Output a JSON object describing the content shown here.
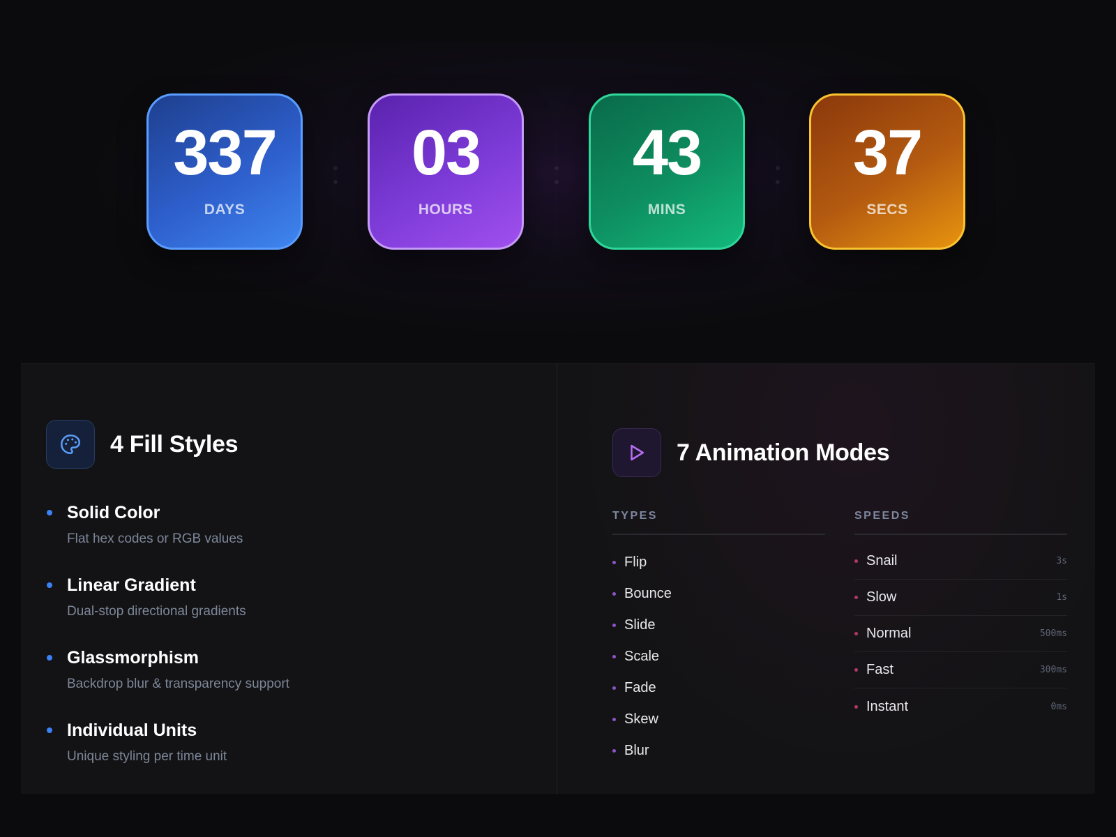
{
  "countdown": {
    "units": [
      {
        "value": "337",
        "label": "DAYS"
      },
      {
        "value": "03",
        "label": "HOURS"
      },
      {
        "value": "43",
        "label": "MINS"
      },
      {
        "value": "37",
        "label": "SECS"
      }
    ]
  },
  "fill_styles": {
    "icon": "palette-icon",
    "title": "4 Fill Styles",
    "items": [
      {
        "title": "Solid Color",
        "desc": "Flat hex codes or RGB values"
      },
      {
        "title": "Linear Gradient",
        "desc": "Dual-stop directional gradients"
      },
      {
        "title": "Glassmorphism",
        "desc": "Backdrop blur & transparency support"
      },
      {
        "title": "Individual Units",
        "desc": "Unique styling per time unit"
      }
    ]
  },
  "animation_modes": {
    "icon": "play-icon",
    "title": "7 Animation Modes",
    "types_label": "TYPES",
    "speeds_label": "SPEEDS",
    "types": [
      "Flip",
      "Bounce",
      "Slide",
      "Scale",
      "Fade",
      "Skew",
      "Blur"
    ],
    "speeds": [
      {
        "name": "Snail",
        "value": "3s"
      },
      {
        "name": "Slow",
        "value": "1s"
      },
      {
        "name": "Normal",
        "value": "500ms"
      },
      {
        "name": "Fast",
        "value": "300ms"
      },
      {
        "name": "Instant",
        "value": "0ms"
      }
    ]
  },
  "colors": {
    "days": "#3f86f0",
    "hours": "#a150ee",
    "mins": "#13b97c",
    "secs": "#e8940f",
    "feature_dot": "#3b82f6",
    "type_dot": "#8b55c8",
    "speed_dot": "#b23a63"
  }
}
